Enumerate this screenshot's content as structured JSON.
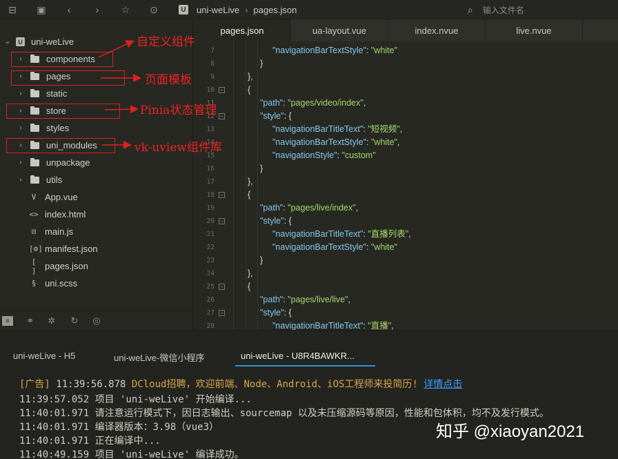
{
  "toolbar": {
    "breadcrumb": {
      "badge": "U",
      "project": "uni-weLive",
      "file": "pages.json"
    },
    "search_placeholder": "输入文件名"
  },
  "sidebar": {
    "root": {
      "label": "uni-weLive",
      "badge": "U"
    },
    "items": [
      {
        "label": "components",
        "type": "folder",
        "icon": "folder-icon"
      },
      {
        "label": "pages",
        "type": "folder",
        "icon": "folder-icon"
      },
      {
        "label": "static",
        "type": "folder",
        "icon": "folder-icon"
      },
      {
        "label": "store",
        "type": "folder",
        "icon": "folder-icon"
      },
      {
        "label": "styles",
        "type": "folder",
        "icon": "folder-icon"
      },
      {
        "label": "uni_modules",
        "type": "folder",
        "icon": "folder-icon"
      },
      {
        "label": "unpackage",
        "type": "folder",
        "icon": "folder-icon"
      },
      {
        "label": "utils",
        "type": "folder",
        "icon": "folder-icon"
      },
      {
        "label": "App.vue",
        "type": "file",
        "icon": "vue-file-icon",
        "glyph": "V"
      },
      {
        "label": "index.html",
        "type": "file",
        "icon": "html-file-icon",
        "glyph": "<>"
      },
      {
        "label": "main.js",
        "type": "file",
        "icon": "js-file-icon",
        "glyph": "⊡"
      },
      {
        "label": "manifest.json",
        "type": "file",
        "icon": "manifest-file-icon",
        "glyph": "[⚙]"
      },
      {
        "label": "pages.json",
        "type": "file",
        "icon": "json-file-icon",
        "glyph": "[ ]"
      },
      {
        "label": "uni.scss",
        "type": "file",
        "icon": "scss-file-icon",
        "glyph": "§"
      }
    ]
  },
  "annotations": [
    {
      "text": "自定义组件",
      "target": "components"
    },
    {
      "text": "页面模板",
      "target": "pages"
    },
    {
      "text": "Pinia状态管理",
      "target": "store"
    },
    {
      "text": "vk-uview组件库",
      "target": "uni_modules"
    }
  ],
  "tabs": [
    {
      "label": "pages.json",
      "active": true
    },
    {
      "label": "ua-layout.vue",
      "active": false
    },
    {
      "label": "index.nvue",
      "active": false
    },
    {
      "label": "live.nvue",
      "active": false
    }
  ],
  "editor": {
    "lines": [
      {
        "n": "7",
        "fold": false,
        "parts": [
          [
            "k",
            "\"navigationBarTextStyle\""
          ],
          [
            "p",
            ": "
          ],
          [
            "s",
            "\"white\""
          ]
        ]
      },
      {
        "n": "8",
        "fold": false,
        "parts": [
          [
            "p",
            "}"
          ]
        ]
      },
      {
        "n": "9",
        "fold": false,
        "parts": [
          [
            "p",
            "},"
          ]
        ]
      },
      {
        "n": "10",
        "fold": true,
        "parts": [
          [
            "p",
            "{"
          ]
        ]
      },
      {
        "n": "11",
        "fold": false,
        "parts": [
          [
            "k",
            "\"path\""
          ],
          [
            "p",
            ": "
          ],
          [
            "s",
            "\"pages/video/index\""
          ],
          [
            "p",
            ","
          ]
        ]
      },
      {
        "n": "12",
        "fold": true,
        "parts": [
          [
            "k",
            "\"style\""
          ],
          [
            "p",
            ": {"
          ]
        ]
      },
      {
        "n": "13",
        "fold": false,
        "parts": [
          [
            "k",
            "\"navigationBarTitleText\""
          ],
          [
            "p",
            ": "
          ],
          [
            "s",
            "\"短视频\""
          ],
          [
            "p",
            ","
          ]
        ]
      },
      {
        "n": "14",
        "fold": false,
        "parts": [
          [
            "k",
            "\"navigationBarTextStyle\""
          ],
          [
            "p",
            ": "
          ],
          [
            "s",
            "\"white\""
          ],
          [
            "p",
            ","
          ]
        ]
      },
      {
        "n": "15",
        "fold": false,
        "parts": [
          [
            "k",
            "\"navigationStyle\""
          ],
          [
            "p",
            ": "
          ],
          [
            "s",
            "\"custom\""
          ]
        ]
      },
      {
        "n": "16",
        "fold": false,
        "parts": [
          [
            "p",
            "}"
          ]
        ]
      },
      {
        "n": "17",
        "fold": false,
        "parts": [
          [
            "p",
            "},"
          ]
        ]
      },
      {
        "n": "18",
        "fold": true,
        "parts": [
          [
            "p",
            "{"
          ]
        ]
      },
      {
        "n": "19",
        "fold": false,
        "parts": [
          [
            "k",
            "\"path\""
          ],
          [
            "p",
            ": "
          ],
          [
            "s",
            "\"pages/live/index\""
          ],
          [
            "p",
            ","
          ]
        ]
      },
      {
        "n": "20",
        "fold": true,
        "parts": [
          [
            "k",
            "\"style\""
          ],
          [
            "p",
            ": {"
          ]
        ]
      },
      {
        "n": "21",
        "fold": false,
        "parts": [
          [
            "k",
            "\"navigationBarTitleText\""
          ],
          [
            "p",
            ": "
          ],
          [
            "s",
            "\"直播列表\""
          ],
          [
            "p",
            ","
          ]
        ]
      },
      {
        "n": "22",
        "fold": false,
        "parts": [
          [
            "k",
            "\"navigationBarTextStyle\""
          ],
          [
            "p",
            ": "
          ],
          [
            "s",
            "\"white\""
          ]
        ]
      },
      {
        "n": "23",
        "fold": false,
        "parts": [
          [
            "p",
            "}"
          ]
        ]
      },
      {
        "n": "24",
        "fold": false,
        "parts": [
          [
            "p",
            "},"
          ]
        ]
      },
      {
        "n": "25",
        "fold": true,
        "parts": [
          [
            "p",
            "{"
          ]
        ]
      },
      {
        "n": "26",
        "fold": false,
        "parts": [
          [
            "k",
            "\"path\""
          ],
          [
            "p",
            ": "
          ],
          [
            "s",
            "\"pages/live/live\""
          ],
          [
            "p",
            ","
          ]
        ]
      },
      {
        "n": "27",
        "fold": true,
        "parts": [
          [
            "k",
            "\"style\""
          ],
          [
            "p",
            ": {"
          ]
        ]
      },
      {
        "n": "28",
        "fold": false,
        "parts": [
          [
            "k",
            "\"navigationBarTitleText\""
          ],
          [
            "p",
            ": "
          ],
          [
            "s",
            "\"直播\""
          ],
          [
            "p",
            ","
          ]
        ]
      }
    ]
  },
  "console": {
    "tabs": [
      {
        "label": "uni-weLive - H5",
        "active": false
      },
      {
        "label": "uni-weLive-微信小程序",
        "active": false
      },
      {
        "label": "uni-weLive - U8R4BAWKR...",
        "active": true
      }
    ],
    "ad": {
      "prefix": "[广告]",
      "time": "11:39:56.878",
      "text": "DCloud招聘，欢迎前端、Node、Android、iOS工程师来投简历!",
      "link": "详情点击"
    },
    "logs": [
      "11:39:57.052 项目 'uni-weLive' 开始编译...",
      "11:40:01.971 请注意运行模式下，因日志输出、sourcemap 以及未压缩源码等原因，性能和包体积，均不及发行模式。",
      "11:40:01.971 编译器版本：3.98（vue3）",
      "11:40:01.971 正在编译中...",
      "11:40:49.159 项目 'uni-weLive' 编译成功。"
    ]
  },
  "watermark": "知乎 @xiaoyan2021",
  "colors": {
    "annotation": "#e02020",
    "key": "#85c9ec",
    "string": "#a6d86a",
    "ad": "#d9a64a",
    "link": "#3aa0ff",
    "active_tab_underline": "#2f8fe0"
  }
}
